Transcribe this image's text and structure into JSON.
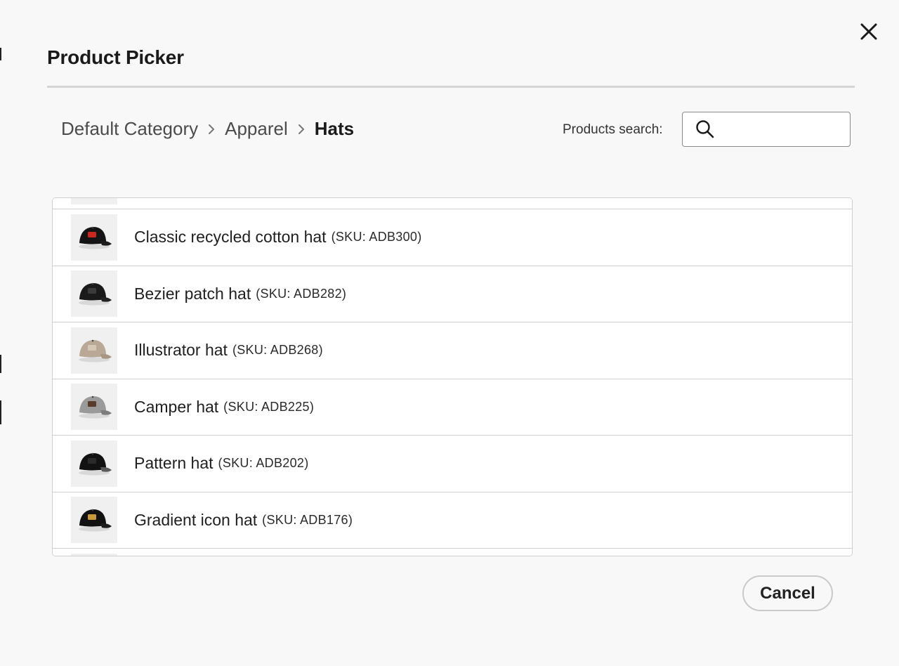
{
  "dialog": {
    "title": "Product Picker",
    "close_icon": "close-icon"
  },
  "breadcrumb": {
    "items": [
      "Default Category",
      "Apparel"
    ],
    "current": "Hats",
    "separator_icon": "chevron-right-icon"
  },
  "search": {
    "label": "Products search:",
    "value": "",
    "placeholder": "",
    "icon": "search-icon"
  },
  "products": [
    {
      "name": "Classic recycled cotton hat",
      "sku": "(SKU: ADB300)",
      "thumb": {
        "cap": "#141414",
        "brim": "#1c1c1c",
        "patch": "#c8281e"
      }
    },
    {
      "name": "Bezier patch hat",
      "sku": "(SKU: ADB282)",
      "thumb": {
        "cap": "#1a1a1a",
        "brim": "#222222",
        "patch": "#3a3a3a"
      }
    },
    {
      "name": "Illustrator hat",
      "sku": "(SKU: ADB268)",
      "thumb": {
        "cap": "#b9a895",
        "brim": "#a89682",
        "patch": "#d6c8b6"
      }
    },
    {
      "name": "Camper hat",
      "sku": "(SKU: ADB225)",
      "thumb": {
        "cap": "#9a9a9a",
        "brim": "#7d7d7d",
        "patch": "#5a3a2a"
      }
    },
    {
      "name": "Pattern hat",
      "sku": "(SKU: ADB202)",
      "thumb": {
        "cap": "#121212",
        "brim": "#5a5a5a",
        "patch": "#2a2a2a"
      }
    },
    {
      "name": "Gradient icon hat",
      "sku": "(SKU: ADB176)",
      "thumb": {
        "cap": "#121212",
        "brim": "#1c1c1c",
        "patch": "#c89a3a"
      }
    }
  ],
  "footer": {
    "cancel_label": "Cancel"
  }
}
